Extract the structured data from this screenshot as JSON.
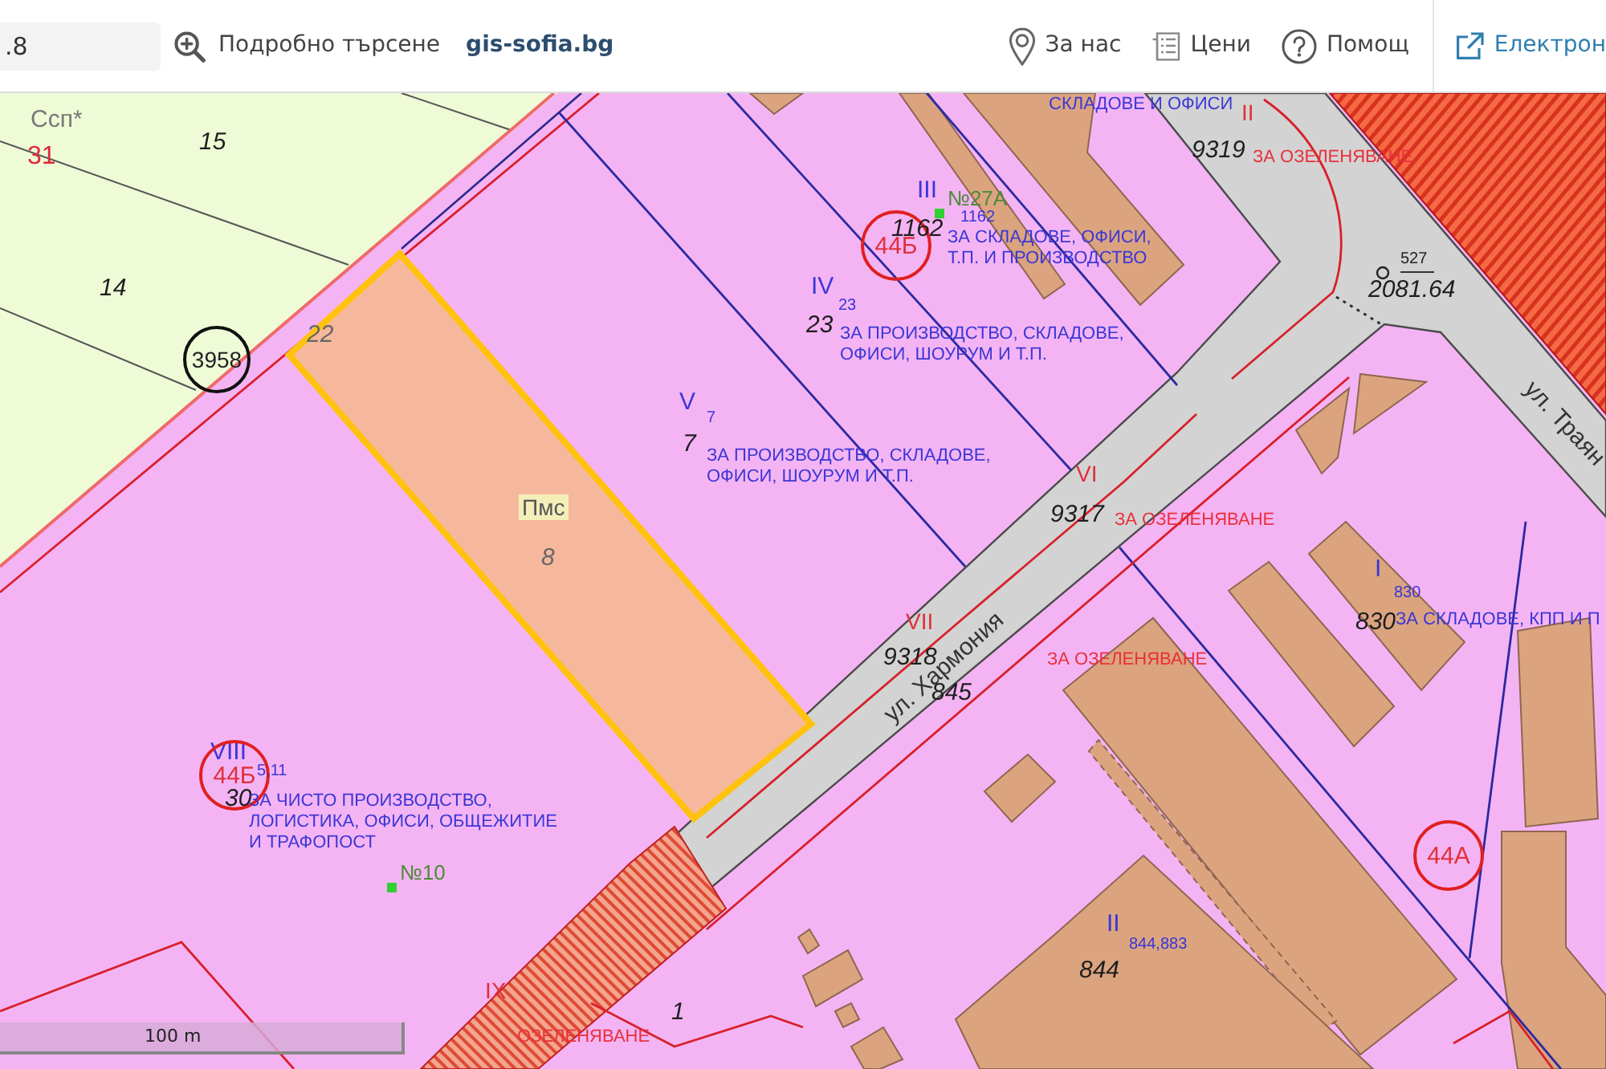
{
  "toolbar": {
    "search": {
      "value": ".8"
    },
    "advanced_search": "Подробно търсене",
    "site_link": "gis-sofia.bg",
    "nav": [
      {
        "label": "За нас",
        "kind": "about"
      },
      {
        "label": "Цени",
        "kind": "prices"
      },
      {
        "label": "Помощ",
        "kind": "help"
      },
      {
        "label": "Електрон",
        "kind": "external"
      }
    ]
  },
  "map": {
    "labels": [
      {
        "text": "Ссп*",
        "kind": "zone-name"
      },
      {
        "text": "СКЛАДОВЕ И ОФИСИ",
        "kind": "purpose"
      },
      {
        "text": "II",
        "kind": "block-red"
      },
      {
        "text": "31",
        "kind": "zone-index"
      },
      {
        "text": "15",
        "kind": "lot"
      },
      {
        "text": "9319",
        "kind": "lot"
      },
      {
        "text": "ЗА ОЗЕЛЕНЯВАНЕ",
        "kind": "greenery"
      },
      {
        "text": "III",
        "kind": "block"
      },
      {
        "text": "№27А",
        "kind": "point"
      },
      {
        "text": "44Б",
        "kind": "circled"
      },
      {
        "text": "1162",
        "kind": "lot"
      },
      {
        "text": "1162",
        "kind": "ref"
      },
      {
        "text": "ЗА СКЛАДОВЕ, ОФИСИ,\nТ.П. И ПРОИЗВОДСТВО",
        "kind": "purpose"
      },
      {
        "text": "527",
        "kind": "fraction"
      },
      {
        "text": "14",
        "kind": "lot"
      },
      {
        "text": "IV",
        "kind": "block"
      },
      {
        "text": "3958",
        "kind": "circled-black"
      },
      {
        "text": "22",
        "kind": "lot-faint"
      },
      {
        "text": "23",
        "kind": "lot"
      },
      {
        "text": "23",
        "kind": "ref"
      },
      {
        "text": "2081.64",
        "kind": "lot"
      },
      {
        "text": "ЗА ПРОИЗВОДСТВО, СКЛАДОВЕ,\nОФИСИ, ШОУРУМ И Т.П.",
        "kind": "purpose"
      },
      {
        "text": "V",
        "kind": "block"
      },
      {
        "text": "7",
        "kind": "ref"
      },
      {
        "text": "7",
        "kind": "lot"
      },
      {
        "text": "ЗА ПРОИЗВОДСТВО, СКЛАДОВЕ,\nОФИСИ, ШОУРУМ И Т.П.",
        "kind": "purpose"
      },
      {
        "text": "VI",
        "kind": "block-red"
      },
      {
        "text": "ул. Траян",
        "kind": "street"
      },
      {
        "text": "Пмс",
        "kind": "plan-zone"
      },
      {
        "text": "9317",
        "kind": "lot"
      },
      {
        "text": "ЗА ОЗЕЛЕНЯВАНЕ",
        "kind": "greenery"
      },
      {
        "text": "8",
        "kind": "lot-faint"
      },
      {
        "text": "I",
        "kind": "block"
      },
      {
        "text": "ул. Хармония",
        "kind": "street"
      },
      {
        "text": "830",
        "kind": "ref"
      },
      {
        "text": "VII",
        "kind": "block-red"
      },
      {
        "text": "830",
        "kind": "lot"
      },
      {
        "text": "ЗА СКЛАДОВЕ, КПП И П",
        "kind": "purpose"
      },
      {
        "text": "9318",
        "kind": "lot"
      },
      {
        "text": "ЗА ОЗЕЛЕНЯВАНЕ",
        "kind": "greenery"
      },
      {
        "text": "845",
        "kind": "lot"
      },
      {
        "text": "VIII",
        "kind": "block"
      },
      {
        "text": "44Б",
        "kind": "circled"
      },
      {
        "text": "5,11",
        "kind": "ref"
      },
      {
        "text": "30",
        "kind": "lot"
      },
      {
        "text": "ЗА ЧИСТО ПРОИЗВОДСТВО,\nЛОГИСТИКА, ОФИСИ, ОБЩЕЖИТИЕ\nИ ТРАФОПОСТ",
        "kind": "purpose"
      },
      {
        "text": "№10",
        "kind": "point"
      },
      {
        "text": "44А",
        "kind": "circled"
      },
      {
        "text": "II",
        "kind": "block"
      },
      {
        "text": "844,883",
        "kind": "ref"
      },
      {
        "text": "IX",
        "kind": "block-red"
      },
      {
        "text": "844",
        "kind": "lot"
      },
      {
        "text": "1",
        "kind": "lot"
      },
      {
        "text": "ОЗЕЛЕНЯВАНЕ",
        "kind": "greenery"
      }
    ],
    "scale_bar": "100 m"
  }
}
